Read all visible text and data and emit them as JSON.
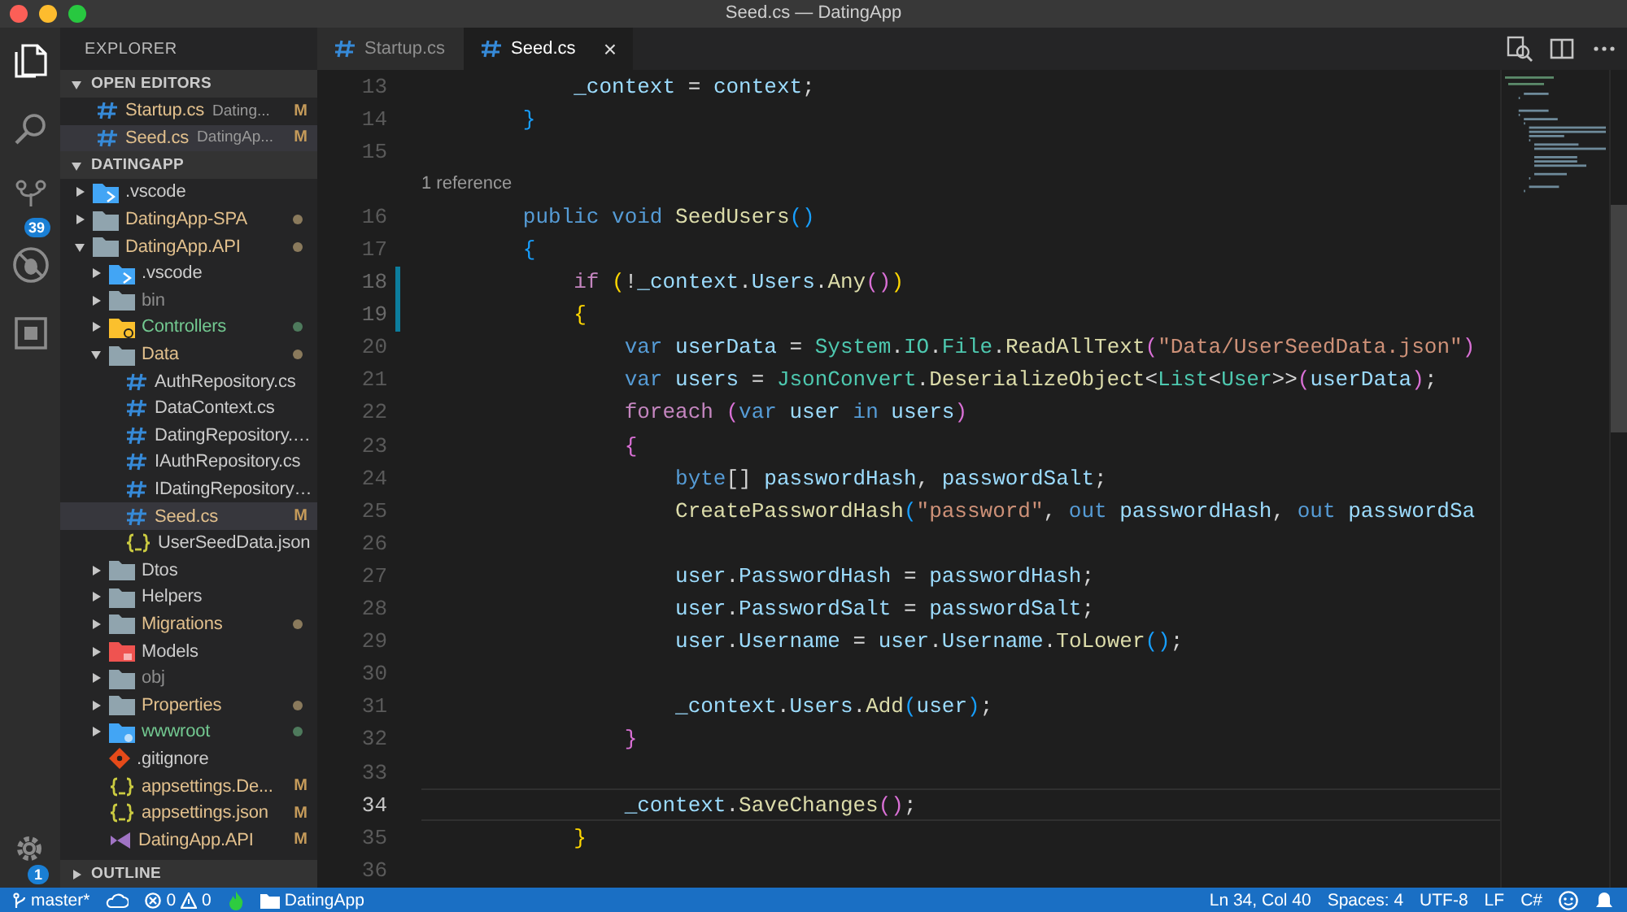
{
  "window": {
    "title": "Seed.cs — DatingApp"
  },
  "activity_bar": [
    {
      "kind": "explorer",
      "selected": true
    },
    {
      "kind": "search",
      "selected": false
    },
    {
      "kind": "scm",
      "selected": false,
      "badge": "39"
    },
    {
      "kind": "debug",
      "selected": false
    },
    {
      "kind": "extensions",
      "selected": false
    }
  ],
  "manage": {
    "badge": "1"
  },
  "sidebar": {
    "title": "EXPLORER",
    "open_editors": {
      "title": "OPEN EDITORS",
      "expanded": true,
      "items": [
        {
          "label": "Startup.cs",
          "description": "Dating...",
          "badge": "M",
          "selected": false
        },
        {
          "label": "Seed.cs",
          "description": "DatingAp...",
          "badge": "M",
          "selected": true
        }
      ]
    },
    "project": {
      "title": "DATINGAPP",
      "expanded": true,
      "items": [
        {
          "label": ".vscode",
          "kind": "folder-vscode",
          "expanded": false,
          "modified": false,
          "untracked": false,
          "ignored": false,
          "selected": false
        },
        {
          "label": "DatingApp-SPA",
          "kind": "folder",
          "expanded": false,
          "modified": true,
          "untracked": false,
          "ignored": false,
          "color": "#8a7a5c",
          "selected": false
        },
        {
          "label": "DatingApp.API",
          "kind": "folder",
          "expanded": true,
          "modified": true,
          "untracked": false,
          "ignored": false,
          "color": "#8a7a5c",
          "selected": false,
          "children": [
            {
              "label": ".vscode",
              "kind": "folder-vscode",
              "expanded": false,
              "modified": false,
              "untracked": false,
              "ignored": false,
              "selected": false
            },
            {
              "label": "bin",
              "kind": "folder",
              "expanded": false,
              "modified": false,
              "untracked": false,
              "ignored": true,
              "selected": false
            },
            {
              "label": "Controllers",
              "kind": "folder-controller",
              "expanded": false,
              "modified": false,
              "untracked": true,
              "ignored": false,
              "color": "#4e7a5c",
              "selected": false
            },
            {
              "label": "Data",
              "kind": "folder",
              "expanded": true,
              "modified": true,
              "untracked": false,
              "ignored": false,
              "color": "#8a7a5c",
              "selected": false,
              "children": [
                {
                  "label": "AuthRepository.cs",
                  "kind": "cs",
                  "modified": false,
                  "untracked": false,
                  "ignored": false,
                  "selected": false
                },
                {
                  "label": "DataContext.cs",
                  "kind": "cs",
                  "modified": false,
                  "untracked": false,
                  "ignored": false,
                  "selected": false
                },
                {
                  "label": "DatingRepository.…",
                  "kind": "cs",
                  "modified": false,
                  "untracked": false,
                  "ignored": false,
                  "selected": false
                },
                {
                  "label": "IAuthRepository.cs",
                  "kind": "cs",
                  "modified": false,
                  "untracked": false,
                  "ignored": false,
                  "selected": false
                },
                {
                  "label": "IDatingRepository…",
                  "kind": "cs",
                  "modified": false,
                  "untracked": false,
                  "ignored": false,
                  "selected": false
                },
                {
                  "label": "Seed.cs",
                  "kind": "cs",
                  "modified": true,
                  "untracked": false,
                  "ignored": false,
                  "badge": "M",
                  "selected": true
                },
                {
                  "label": "UserSeedData.json",
                  "kind": "json",
                  "modified": false,
                  "untracked": false,
                  "ignored": false,
                  "selected": false
                }
              ]
            },
            {
              "label": "Dtos",
              "kind": "folder",
              "expanded": false,
              "modified": false,
              "untracked": false,
              "ignored": false,
              "selected": false
            },
            {
              "label": "Helpers",
              "kind": "folder",
              "expanded": false,
              "modified": false,
              "untracked": false,
              "ignored": false,
              "selected": false
            },
            {
              "label": "Migrations",
              "kind": "folder",
              "expanded": false,
              "modified": true,
              "untracked": false,
              "ignored": false,
              "color": "#8a7a5c",
              "selected": false
            },
            {
              "label": "Models",
              "kind": "folder-models",
              "expanded": false,
              "modified": false,
              "untracked": false,
              "ignored": false,
              "selected": false
            },
            {
              "label": "obj",
              "kind": "folder",
              "expanded": false,
              "modified": false,
              "untracked": false,
              "ignored": true,
              "selected": false
            },
            {
              "label": "Properties",
              "kind": "folder",
              "expanded": false,
              "modified": true,
              "untracked": false,
              "ignored": false,
              "color": "#8a7a5c",
              "selected": false
            },
            {
              "label": "wwwroot",
              "kind": "folder-web",
              "expanded": false,
              "modified": false,
              "untracked": true,
              "ignored": false,
              "color": "#4e7a5c",
              "selected": false
            },
            {
              "label": ".gitignore",
              "kind": "git",
              "modified": false,
              "untracked": false,
              "ignored": false,
              "selected": false
            },
            {
              "label": "appsettings.De...",
              "kind": "json",
              "modified": true,
              "untracked": false,
              "ignored": false,
              "badge": "M",
              "selected": false
            },
            {
              "label": "appsettings.json",
              "kind": "json",
              "modified": true,
              "untracked": false,
              "ignored": false,
              "badge": "M",
              "selected": false
            },
            {
              "label": "DatingApp.API",
              "kind": "vsproj",
              "modified": true,
              "untracked": false,
              "ignored": false,
              "badge": "M",
              "selected": false
            }
          ]
        }
      ]
    },
    "outline": {
      "title": "OUTLINE",
      "expanded": false
    }
  },
  "tabs": [
    {
      "label": "Startup.cs",
      "selected": false
    },
    {
      "label": "Seed.cs",
      "selected": true,
      "close": "×"
    }
  ],
  "editor": {
    "lines": [
      {
        "kind": "code",
        "number": "13",
        "changed": false,
        "current": false,
        "tokens": [
          {
            "kind": "var",
            "text": "            _context"
          },
          {
            "kind": "p",
            "text": " = "
          },
          {
            "kind": "var",
            "text": "context"
          },
          {
            "kind": "p",
            "text": ";"
          }
        ]
      },
      {
        "kind": "code",
        "number": "14",
        "changed": false,
        "current": false,
        "tokens": [
          {
            "kind": "b1",
            "text": "        }"
          }
        ]
      },
      {
        "kind": "code",
        "number": "15",
        "changed": false,
        "current": false
      },
      {
        "kind": "codelens",
        "text": "1 reference"
      },
      {
        "kind": "code",
        "number": "16",
        "changed": false,
        "current": false,
        "tokens": [
          {
            "kind": "kw",
            "text": "        public"
          },
          {
            "kind": "kw",
            "text": " void"
          },
          {
            "kind": "fn",
            "text": " SeedUsers"
          },
          {
            "kind": "b1",
            "text": "()"
          }
        ]
      },
      {
        "kind": "code",
        "number": "17",
        "changed": false,
        "current": false,
        "tokens": [
          {
            "kind": "b1",
            "text": "        {"
          }
        ]
      },
      {
        "kind": "code",
        "number": "18",
        "changed": true,
        "current": false,
        "tokens": [
          {
            "kind": "ctrl",
            "text": "            if"
          },
          {
            "kind": "b2",
            "text": " ("
          },
          {
            "kind": "p",
            "text": "!"
          },
          {
            "kind": "var",
            "text": "_context"
          },
          {
            "kind": "p",
            "text": "."
          },
          {
            "kind": "var",
            "text": "Users"
          },
          {
            "kind": "p",
            "text": "."
          },
          {
            "kind": "fn",
            "text": "Any"
          },
          {
            "kind": "b3",
            "text": "()"
          },
          {
            "kind": "b2",
            "text": ")"
          }
        ]
      },
      {
        "kind": "code",
        "number": "19",
        "changed": true,
        "current": false,
        "tokens": [
          {
            "kind": "b2",
            "text": "            {"
          }
        ]
      },
      {
        "kind": "code",
        "number": "20",
        "changed": false,
        "current": false,
        "tokens": [
          {
            "kind": "kw",
            "text": "                var"
          },
          {
            "kind": "var",
            "text": " userData"
          },
          {
            "kind": "p",
            "text": " = "
          },
          {
            "kind": "type",
            "text": "System"
          },
          {
            "kind": "p",
            "text": "."
          },
          {
            "kind": "type",
            "text": "IO"
          },
          {
            "kind": "p",
            "text": "."
          },
          {
            "kind": "type",
            "text": "File"
          },
          {
            "kind": "p",
            "text": "."
          },
          {
            "kind": "fn",
            "text": "ReadAllText"
          },
          {
            "kind": "b3",
            "text": "("
          },
          {
            "kind": "str",
            "text": "\"Data/UserSeedData.json\""
          },
          {
            "kind": "b3",
            "text": ")"
          }
        ]
      },
      {
        "kind": "code",
        "number": "21",
        "changed": false,
        "current": false,
        "tokens": [
          {
            "kind": "kw",
            "text": "                var"
          },
          {
            "kind": "var",
            "text": " users"
          },
          {
            "kind": "p",
            "text": " = "
          },
          {
            "kind": "type",
            "text": "JsonConvert"
          },
          {
            "kind": "p",
            "text": "."
          },
          {
            "kind": "fn",
            "text": "DeserializeObject"
          },
          {
            "kind": "p",
            "text": "<"
          },
          {
            "kind": "type",
            "text": "List"
          },
          {
            "kind": "p",
            "text": "<"
          },
          {
            "kind": "type",
            "text": "User"
          },
          {
            "kind": "p",
            "text": ">>"
          },
          {
            "kind": "b3",
            "text": "("
          },
          {
            "kind": "var",
            "text": "userData"
          },
          {
            "kind": "b3",
            "text": ")"
          },
          {
            "kind": "p",
            "text": ";"
          }
        ]
      },
      {
        "kind": "code",
        "number": "22",
        "changed": false,
        "current": false,
        "tokens": [
          {
            "kind": "ctrl",
            "text": "                foreach"
          },
          {
            "kind": "b3",
            "text": " ("
          },
          {
            "kind": "kw",
            "text": "var"
          },
          {
            "kind": "var",
            "text": " user"
          },
          {
            "kind": "kw",
            "text": " in"
          },
          {
            "kind": "var",
            "text": " users"
          },
          {
            "kind": "b3",
            "text": ")"
          }
        ]
      },
      {
        "kind": "code",
        "number": "23",
        "changed": false,
        "current": false,
        "tokens": [
          {
            "kind": "b3",
            "text": "                {"
          }
        ]
      },
      {
        "kind": "code",
        "number": "24",
        "changed": false,
        "current": false,
        "tokens": [
          {
            "kind": "kw",
            "text": "                    byte"
          },
          {
            "kind": "p",
            "text": "[]"
          },
          {
            "kind": "var",
            "text": " passwordHash"
          },
          {
            "kind": "p",
            "text": ","
          },
          {
            "kind": "var",
            "text": " passwordSalt"
          },
          {
            "kind": "p",
            "text": ";"
          }
        ]
      },
      {
        "kind": "code",
        "number": "25",
        "changed": false,
        "current": false,
        "tokens": [
          {
            "kind": "fn",
            "text": "                    CreatePasswordHash"
          },
          {
            "kind": "b1",
            "text": "("
          },
          {
            "kind": "str",
            "text": "\"password\""
          },
          {
            "kind": "p",
            "text": ","
          },
          {
            "kind": "kw",
            "text": " out"
          },
          {
            "kind": "var",
            "text": " passwordHash"
          },
          {
            "kind": "p",
            "text": ","
          },
          {
            "kind": "kw",
            "text": " out"
          },
          {
            "kind": "var",
            "text": " passwordSa"
          }
        ]
      },
      {
        "kind": "code",
        "number": "26",
        "changed": false,
        "current": false
      },
      {
        "kind": "code",
        "number": "27",
        "changed": false,
        "current": false,
        "tokens": [
          {
            "kind": "var",
            "text": "                    user"
          },
          {
            "kind": "p",
            "text": "."
          },
          {
            "kind": "var",
            "text": "PasswordHash"
          },
          {
            "kind": "p",
            "text": " = "
          },
          {
            "kind": "var",
            "text": "passwordHash"
          },
          {
            "kind": "p",
            "text": ";"
          }
        ]
      },
      {
        "kind": "code",
        "number": "28",
        "changed": false,
        "current": false,
        "tokens": [
          {
            "kind": "var",
            "text": "                    user"
          },
          {
            "kind": "p",
            "text": "."
          },
          {
            "kind": "var",
            "text": "PasswordSalt"
          },
          {
            "kind": "p",
            "text": " = "
          },
          {
            "kind": "var",
            "text": "passwordSalt"
          },
          {
            "kind": "p",
            "text": ";"
          }
        ]
      },
      {
        "kind": "code",
        "number": "29",
        "changed": false,
        "current": false,
        "tokens": [
          {
            "kind": "var",
            "text": "                    user"
          },
          {
            "kind": "p",
            "text": "."
          },
          {
            "kind": "var",
            "text": "Username"
          },
          {
            "kind": "p",
            "text": " = "
          },
          {
            "kind": "var",
            "text": "user"
          },
          {
            "kind": "p",
            "text": "."
          },
          {
            "kind": "var",
            "text": "Username"
          },
          {
            "kind": "p",
            "text": "."
          },
          {
            "kind": "fn",
            "text": "ToLower"
          },
          {
            "kind": "b1",
            "text": "()"
          },
          {
            "kind": "p",
            "text": ";"
          }
        ]
      },
      {
        "kind": "code",
        "number": "30",
        "changed": false,
        "current": false
      },
      {
        "kind": "code",
        "number": "31",
        "changed": false,
        "current": false,
        "tokens": [
          {
            "kind": "var",
            "text": "                    _context"
          },
          {
            "kind": "p",
            "text": "."
          },
          {
            "kind": "var",
            "text": "Users"
          },
          {
            "kind": "p",
            "text": "."
          },
          {
            "kind": "fn",
            "text": "Add"
          },
          {
            "kind": "b1",
            "text": "("
          },
          {
            "kind": "var",
            "text": "user"
          },
          {
            "kind": "b1",
            "text": ")"
          },
          {
            "kind": "p",
            "text": ";"
          }
        ]
      },
      {
        "kind": "code",
        "number": "32",
        "changed": false,
        "current": false,
        "tokens": [
          {
            "kind": "b3",
            "text": "                }"
          }
        ]
      },
      {
        "kind": "code",
        "number": "33",
        "changed": false,
        "current": false
      },
      {
        "kind": "code",
        "number": "34",
        "changed": false,
        "current": true,
        "tokens": [
          {
            "kind": "var",
            "text": "                _context"
          },
          {
            "kind": "p",
            "text": "."
          },
          {
            "kind": "fn",
            "text": "SaveChanges"
          },
          {
            "kind": "b3",
            "text": "()"
          },
          {
            "kind": "p",
            "text": ";"
          }
        ]
      },
      {
        "kind": "code",
        "number": "35",
        "changed": false,
        "current": false,
        "tokens": [
          {
            "kind": "b2",
            "text": "            }"
          }
        ]
      },
      {
        "kind": "code",
        "number": "36",
        "changed": false,
        "current": false
      }
    ]
  },
  "status_bar": {
    "branch": "master*",
    "errors": "0",
    "warnings": "0",
    "folder": "DatingApp",
    "right": [
      "Ln 34, Col 40",
      "Spaces: 4",
      "UTF-8",
      "LF",
      "C#"
    ]
  }
}
